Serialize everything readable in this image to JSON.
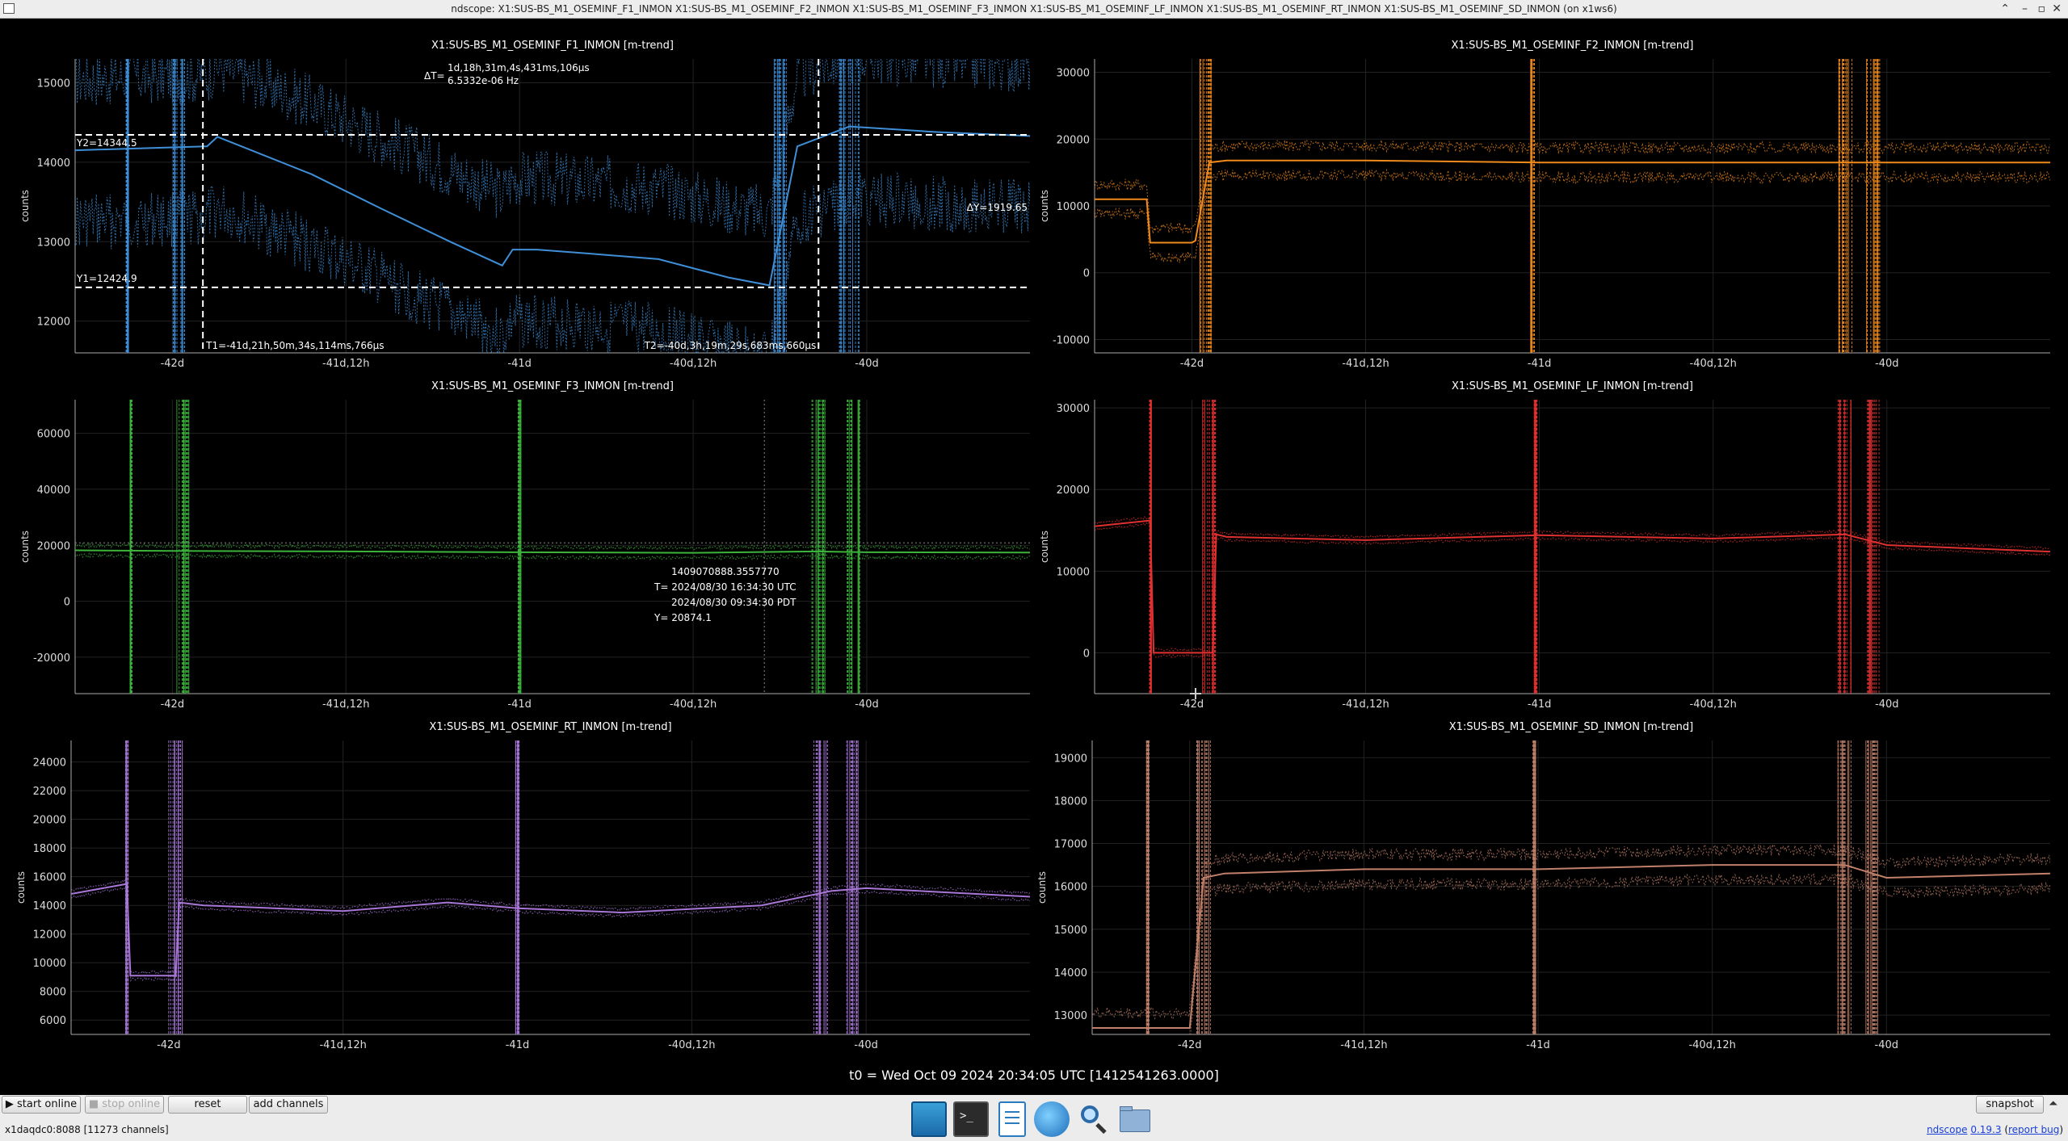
{
  "window": {
    "title": "ndscope: X1:SUS-BS_M1_OSEMINF_F1_INMON X1:SUS-BS_M1_OSEMINF_F2_INMON X1:SUS-BS_M1_OSEMINF_F3_INMON X1:SUS-BS_M1_OSEMINF_LF_INMON X1:SUS-BS_M1_OSEMINF_RT_INMON X1:SUS-BS_M1_OSEMINF_SD_INMON (on x1ws6)",
    "controls": [
      "⌃",
      "–",
      "▫",
      "✕"
    ]
  },
  "colors": {
    "F1": "#3f8fd8",
    "F2": "#ef8a1c",
    "F3": "#3cb43c",
    "LF": "#e03030",
    "RT": "#a877d8",
    "SD": "#c0806a"
  },
  "chart_data": [
    {
      "type": "line",
      "title": "X1:SUS-BS_M1_OSEMINF_F1_INMON [m-trend]",
      "ylabel": "counts",
      "xticks": [
        "-42d",
        "-41d,12h",
        "-41d",
        "-40d,12h",
        "-40d"
      ],
      "xtick_values": [
        -42,
        -41.5,
        -41,
        -40.5,
        -40
      ],
      "xlim": [
        -42.28,
        -39.53
      ],
      "yticks": [
        "12000",
        "13000",
        "14000",
        "15000"
      ],
      "ylim": [
        11600,
        15300
      ],
      "series": [
        {
          "x": [
            -42.28,
            -41.9,
            -41.87,
            -41.6,
            -41.4,
            -41.2,
            -41.05,
            -41.02,
            -40.95,
            -40.8,
            -40.6,
            -40.4,
            -40.28,
            -40.2,
            -40.05,
            -39.8,
            -39.53
          ],
          "values": [
            14150,
            14200,
            14320,
            13850,
            13420,
            13000,
            12700,
            12900,
            12900,
            12850,
            12780,
            12550,
            12450,
            14200,
            14450,
            14380,
            14330
          ]
        }
      ],
      "cursors": {
        "y2": "Y2=14344.5",
        "y1": "Y1=12424.9",
        "dy": "ΔY=1919.65",
        "t1": "T1=-41d,21h,50m,34s,114ms,766µs",
        "t2": "T2=-40d,3h,19m,29s,683ms,660µs",
        "dt_label": "ΔT=",
        "dt": "1d,18h,31m,4s,431ms,106µs",
        "freq": "6.5332e-06 Hz"
      }
    },
    {
      "type": "line",
      "title": "X1:SUS-BS_M1_OSEMINF_F2_INMON [m-trend]",
      "ylabel": "counts",
      "xticks": [
        "-42d",
        "-41d,12h",
        "-41d",
        "-40d,12h",
        "-40d"
      ],
      "xtick_values": [
        -42,
        -41.5,
        -41,
        -40.5,
        -40
      ],
      "xlim": [
        -42.28,
        -39.53
      ],
      "yticks": [
        "-10000",
        "0",
        "10000",
        "20000",
        "30000"
      ],
      "ylim": [
        -12000,
        32000
      ],
      "series": [
        {
          "x": [
            -42.28,
            -42.13,
            -42.12,
            -42.0,
            -41.99,
            -41.95,
            -41.9,
            -41.5,
            -41.0,
            -40.5,
            -40.1,
            -39.53
          ],
          "values": [
            11000,
            11000,
            4500,
            4500,
            4800,
            16500,
            16800,
            16800,
            16500,
            16500,
            16500,
            16500
          ]
        }
      ]
    },
    {
      "type": "line",
      "title": "X1:SUS-BS_M1_OSEMINF_F3_INMON [m-trend]",
      "ylabel": "counts",
      "xticks": [
        "-42d",
        "-41d,12h",
        "-41d",
        "-40d,12h",
        "-40d"
      ],
      "xtick_values": [
        -42,
        -41.5,
        -41,
        -40.5,
        -40
      ],
      "xlim": [
        -42.28,
        -39.53
      ],
      "yticks": [
        "-20000",
        "0",
        "20000",
        "40000",
        "60000"
      ],
      "ylim": [
        -33000,
        72000
      ],
      "series": [
        {
          "x": [
            -42.28,
            -42.0,
            -41.5,
            -41.0,
            -40.5,
            -40.15,
            -40.0,
            -39.53
          ],
          "values": [
            18200,
            18000,
            17800,
            17500,
            17300,
            17800,
            17500,
            17400
          ]
        }
      ],
      "readout": {
        "gps": "1409070888.3557770",
        "utc": "T= 2024/08/30 16:34:30 UTC",
        "pdt": "2024/08/30 09:34:30 PDT",
        "y": "Y= 20874.1"
      }
    },
    {
      "type": "line",
      "title": "X1:SUS-BS_M1_OSEMINF_LF_INMON [m-trend]",
      "ylabel": "counts",
      "xticks": [
        "-42d",
        "-41d,12h",
        "-41d",
        "-40d,12h",
        "-40d"
      ],
      "xtick_values": [
        -42,
        -41.5,
        -41,
        -40.5,
        -40
      ],
      "xlim": [
        -42.28,
        -39.53
      ],
      "yticks": [
        "0",
        "10000",
        "20000",
        "30000"
      ],
      "ylim": [
        -5000,
        31000
      ],
      "series": [
        {
          "x": [
            -42.28,
            -42.12,
            -42.11,
            -41.94,
            -41.93,
            -41.9,
            -41.5,
            -41.0,
            -40.5,
            -40.12,
            -40.0,
            -39.53
          ],
          "values": [
            15500,
            16200,
            0,
            0,
            14500,
            14200,
            13800,
            14400,
            14000,
            14500,
            13200,
            12400
          ]
        }
      ]
    },
    {
      "type": "line",
      "title": "X1:SUS-BS_M1_OSEMINF_RT_INMON [m-trend]",
      "ylabel": "counts",
      "xticks": [
        "-42d",
        "-41d,12h",
        "-41d",
        "-40d,12h",
        "-40d"
      ],
      "xtick_values": [
        -42,
        -41.5,
        -41,
        -40.5,
        -40
      ],
      "xlim": [
        -42.28,
        -39.53
      ],
      "yticks": [
        "6000",
        "8000",
        "10000",
        "12000",
        "14000",
        "16000",
        "18000",
        "20000",
        "22000",
        "24000"
      ],
      "ylim": [
        5000,
        25500
      ],
      "series": [
        {
          "x": [
            -42.28,
            -42.12,
            -42.11,
            -41.98,
            -41.97,
            -41.9,
            -41.5,
            -41.2,
            -41.0,
            -40.7,
            -40.3,
            -40.1,
            -40.0,
            -39.53
          ],
          "values": [
            14800,
            15500,
            9100,
            9100,
            14200,
            14000,
            13600,
            14200,
            13800,
            13500,
            14000,
            15000,
            15200,
            14600
          ]
        }
      ]
    },
    {
      "type": "line",
      "title": "X1:SUS-BS_M1_OSEMINF_SD_INMON [m-trend]",
      "ylabel": "counts",
      "xticks": [
        "-42d",
        "-41d,12h",
        "-41d",
        "-40d,12h",
        "-40d"
      ],
      "xtick_values": [
        -42,
        -41.5,
        -41,
        -40.5,
        -40
      ],
      "xlim": [
        -42.28,
        -39.53
      ],
      "yticks": [
        "13000",
        "14000",
        "15000",
        "16000",
        "17000",
        "18000",
        "19000"
      ],
      "ylim": [
        12550,
        19400
      ],
      "series": [
        {
          "x": [
            -42.28,
            -42.12,
            -42.11,
            -42.0,
            -41.96,
            -41.9,
            -41.5,
            -41.0,
            -40.5,
            -40.12,
            -40.0,
            -39.53
          ],
          "values": [
            12700,
            12700,
            12700,
            12700,
            16200,
            16300,
            16400,
            16400,
            16500,
            16500,
            16200,
            16300
          ]
        }
      ]
    }
  ],
  "t0": "t0 = Wed Oct 09 2024 20:34:05 UTC [1412541263.0000]",
  "buttons": {
    "start_online": "▶ start online",
    "stop_online": "■ stop online",
    "reset": "reset",
    "add_channels": "add channels",
    "snapshot": "snapshot",
    "expand": "⏶"
  },
  "status": "x1daqdc0:8088  [11273 channels]",
  "version": {
    "app": "ndscope",
    "num": "0.19.3",
    "bug": "report bug"
  },
  "taskbar": [
    "window-list-icon",
    "terminal-icon",
    "document-icon",
    "globe-icon",
    "magnifier-icon",
    "folder-icon"
  ]
}
